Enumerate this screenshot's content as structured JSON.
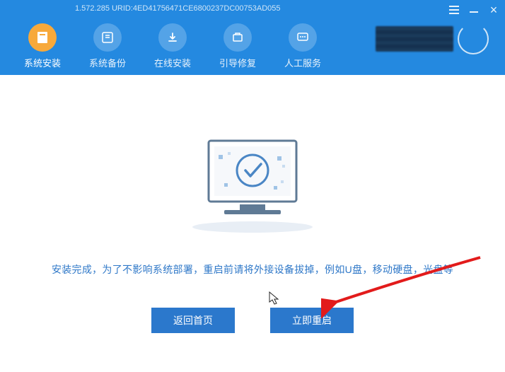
{
  "titlebar": {
    "version_text": "1.572.285  URID:4ED41756471CE6800237DC00753AD055"
  },
  "nav": {
    "items": [
      {
        "label": "系统安装",
        "icon": "install-icon"
      },
      {
        "label": "系统备份",
        "icon": "backup-icon"
      },
      {
        "label": "在线安装",
        "icon": "download-icon"
      },
      {
        "label": "引导修复",
        "icon": "repair-icon"
      },
      {
        "label": "人工服务",
        "icon": "chat-icon"
      }
    ]
  },
  "content": {
    "message": "安装完成，为了不影响系统部署，重启前请将外接设备拔掉，例如U盘，移动硬盘，光盘等",
    "back_label": "返回首页",
    "restart_label": "立即重启"
  },
  "colors": {
    "primary": "#2489e0",
    "button": "#2b78cc",
    "accent": "#f7a93b"
  }
}
